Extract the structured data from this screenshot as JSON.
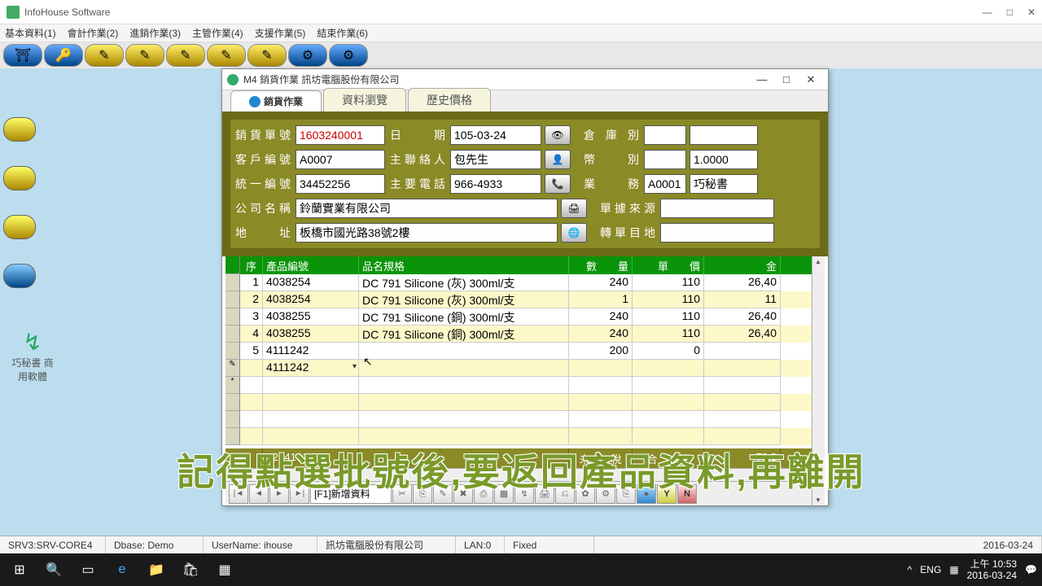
{
  "outer": {
    "title": "InfoHouse Software"
  },
  "menu": {
    "m1": "基本資料(1)",
    "m2": "會計作業(2)",
    "m3": "進銷作業(3)",
    "m4": "主管作業(4)",
    "m5": "支援作業(5)",
    "m6": "結束作業(6)"
  },
  "inner": {
    "title": "M4 銷貨作業 訊坊電腦股份有限公司"
  },
  "tabs": {
    "t1": "銷貨作業",
    "t2": "資料瀏覽",
    "t3": "歷史價格"
  },
  "form": {
    "l_orderno": "銷貨單號",
    "orderno": "1603240001",
    "l_date": "日　　期",
    "date": "105-03-24",
    "l_wh": "倉 庫 別",
    "wh1": "",
    "wh2": "",
    "l_cust": "客戶編號",
    "cust": "A0007",
    "l_contact": "主聯絡人",
    "contact": "包先生",
    "l_curr": "幣　　別",
    "curr": "",
    "rate": "1.0000",
    "l_uni": "統一編號",
    "uni": "34452256",
    "l_tel": "主要電話",
    "tel": "966-4933",
    "l_sales": "業　　務",
    "sales1": "A0001",
    "sales2": "巧秘書",
    "l_comp": "公司名稱",
    "comp": "鈴蘭實業有限公司",
    "l_src": "單據來源",
    "src": "",
    "l_addr": "地　　址",
    "addr": "板橋市國光路38號2樓",
    "l_dest": "轉單目地",
    "dest": ""
  },
  "grid": {
    "h_seq": "序",
    "h_pid": "產品編號",
    "h_spec": "品名規格",
    "h_qty": "數　　量",
    "h_price": "單　　價",
    "h_amt": "金",
    "rows": [
      {
        "seq": "1",
        "pid": "4038254",
        "spec": "DC 791 Silicone (灰) 300ml/支",
        "qty": "240",
        "price": "110",
        "amt": "26,40"
      },
      {
        "seq": "2",
        "pid": "4038254",
        "spec": "DC 791 Silicone (灰) 300ml/支",
        "qty": "1",
        "price": "110",
        "amt": "11"
      },
      {
        "seq": "3",
        "pid": "4038255",
        "spec": "DC 791 Silicone (銅) 300ml/支",
        "qty": "240",
        "price": "110",
        "amt": "26,40"
      },
      {
        "seq": "4",
        "pid": "4038255",
        "spec": "DC 791 Silicone (銅) 300ml/支",
        "qty": "240",
        "price": "110",
        "amt": "26,40"
      },
      {
        "seq": "5",
        "pid": "4111242",
        "spec": "",
        "qty": "200",
        "price": "0",
        "amt": ""
      }
    ],
    "editing_pid": "4111242",
    "foot_code": "<2>4101.000",
    "foot_l1": "未　　稅",
    "foot_l2": "合　　計",
    "foot_amt": "79,3",
    "tb_placeholder": "[F1]新增資料"
  },
  "overlay": "記得點選批號後,要返回產品資料,再離開",
  "status": {
    "s1": "SRV3:SRV-CORE4",
    "s2": "Dbase: Demo",
    "s3": "UserName: ihouse",
    "s4": "訊坊電腦股份有限公司",
    "s5": "LAN:0",
    "s6": "Fixed",
    "s7": "2016-03-24"
  },
  "tray": {
    "lang": "ENG",
    "time": "上午 10:53",
    "date": "2016-03-24"
  },
  "brand": "巧秘書 商用軟體"
}
